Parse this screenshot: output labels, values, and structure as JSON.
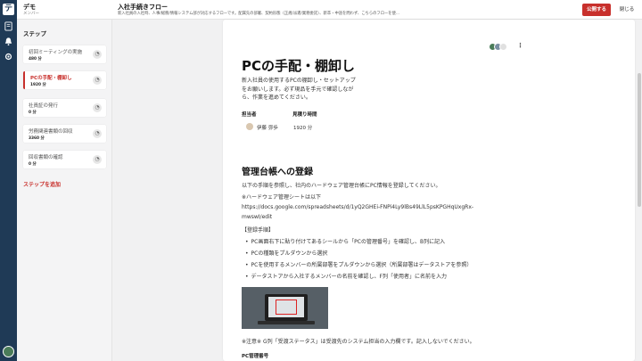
{
  "workspace": {
    "name": "デモ",
    "role": "メンバー"
  },
  "flow": {
    "title": "入社手続きフロー",
    "description": "新入社員の入社時、人事/総務/情報システム部が対応するフローです。配属先の部署、契約形態（正規/派遣/業務委託）、新卒・中途を問わず、こちらのフローを使..."
  },
  "actions": {
    "publish": "公開する",
    "close": "閉じる"
  },
  "sidebar": {
    "title": "ステップ",
    "steps": [
      {
        "name": "初回ミーティングの実施",
        "time": "480 分"
      },
      {
        "name": "PCの手配・棚卸し",
        "time": "1920 分"
      },
      {
        "name": "社員証の発行",
        "time": "0 分"
      },
      {
        "name": "労務関連書類の回収",
        "time": "3360 分"
      },
      {
        "name": "回収書類の確認",
        "time": "0 分"
      }
    ],
    "add": "ステップを追加"
  },
  "step": {
    "title": "PCの手配・棚卸し",
    "lead": "新入社員の使用するPCの棚卸し・セットアップをお願いします。必ず現品を手元で確認しながら、作業を進めてください。",
    "assignee_label": "担当者",
    "assignee": "伊藤 弥歩",
    "estimate_label": "見積り時間",
    "estimate": "1920 分",
    "section_title": "管理台帳への登録",
    "p1": "以下の手順を参照し、社内のハードウェア管理台帳にPC情報を登録してください。",
    "p2": "※ハードウェア管理シートは以下",
    "link1": "https://docs.google.com/spreadsheets/d/1yQ2GHEi-FNPi4Ly9lBs49LlL5psKPGHqUxgRx-",
    "link2": "mwswI/edit",
    "p3": "【登録手順】",
    "bullets": [
      "PC画面右下に貼り付けてあるシールから「PCの管理番号」を確認し、B列に記入",
      "PCの種類をプルダウンから選択",
      "PCを使用するメンバーの所属部署をプルダウンから選択（所属部署はデータストアを参照）",
      "データストアから入社するメンバーの名前を確認し、F列「使用者」に名前を入力"
    ],
    "note": "※注意※ G列「受渡ステータス」は受渡先のシステム担当の入力欄です。記入しないでください。",
    "field_label": "PC管理番号"
  },
  "icons": {
    "rail": [
      "document-icon",
      "bell-icon",
      "gear-icon"
    ],
    "step": "progress-icon",
    "more": "more-vertical-icon"
  },
  "colors": {
    "accent": "#c8302c",
    "rail": "#1f3a56"
  }
}
